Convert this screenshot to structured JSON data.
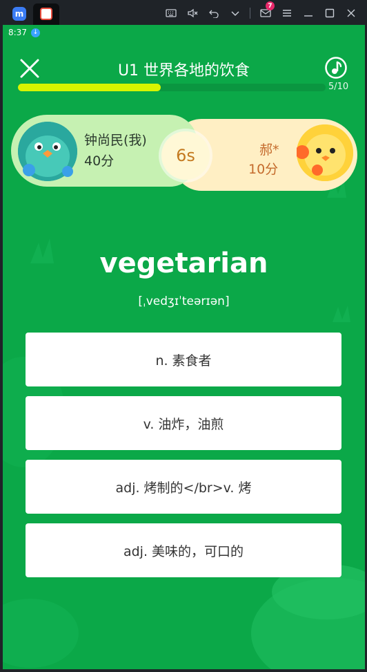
{
  "emulator": {
    "mail_badge": "7",
    "icons": [
      "keyboard-icon",
      "mute-icon",
      "undo-icon",
      "chevron-down-icon",
      "mail-icon",
      "menu-icon",
      "minimize-icon",
      "maximize-icon",
      "close-icon"
    ]
  },
  "status_bar": {
    "time": "8:37"
  },
  "header": {
    "title": "U1 世界各地的饮食",
    "progress_text": "5/10",
    "progress_fraction": 0.465
  },
  "battle": {
    "player1": {
      "name": "钟尚民(我)",
      "score": "40分"
    },
    "player2": {
      "name": "郝*",
      "score": "10分"
    },
    "timer": "6s"
  },
  "question": {
    "word": "vegetarian",
    "phonetic": "[ˌvedʒɪˈteərɪən]"
  },
  "options": [
    {
      "label": "n. 素食者"
    },
    {
      "label": "v. 油炸，油煎"
    },
    {
      "label": "adj. 烤制的</br>v. 烤"
    },
    {
      "label": "adj. 美味的，可口的"
    }
  ],
  "colors": {
    "background": "#0ba848",
    "progress_fill": "#d8f400",
    "player1_panel": "#c6f1b2",
    "player2_panel": "#ffefc4"
  }
}
